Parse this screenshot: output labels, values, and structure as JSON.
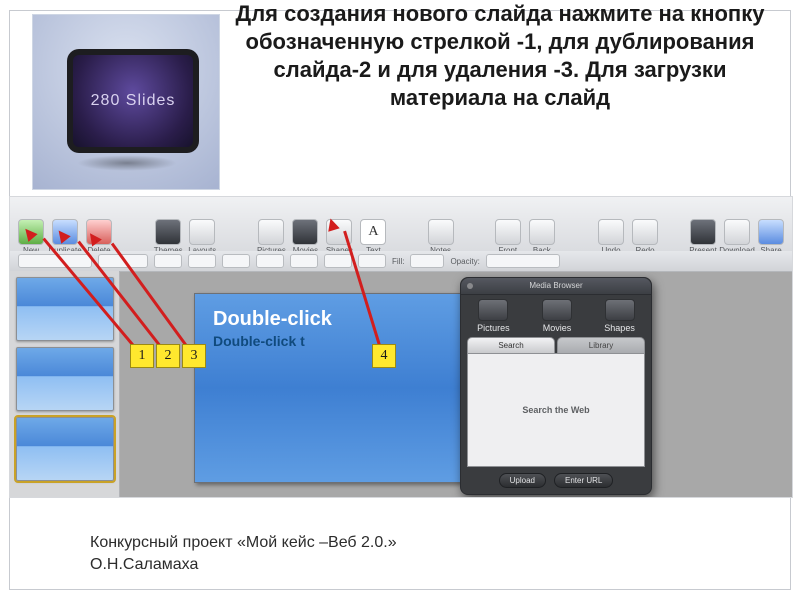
{
  "instruction_heading": "Для создания нового слайда нажмите на кнопку обозначенную стрелкой -1, для дублирования слайда-2 и для удаления -3. Для загрузки материала на слайд",
  "logo_text": "280 Slides",
  "toolbar": {
    "new": "New",
    "duplicate": "Duplicate",
    "delete": "Delete",
    "themes": "Themes",
    "layouts": "Layouts",
    "pictures": "Pictures",
    "movies": "Movies",
    "shapes": "Shapes",
    "text": "Text",
    "notes": "Notes",
    "front": "Front",
    "back": "Back",
    "undo": "Undo",
    "redo": "Redo",
    "present": "Present",
    "download": "Download",
    "share": "Share"
  },
  "toolbar2": {
    "fill_label": "Fill:",
    "opacity_label": "Opacity:"
  },
  "slide": {
    "line1": "Double-click",
    "line2": "Double-click t"
  },
  "media_browser": {
    "title": "Media Browser",
    "cat_pictures": "Pictures",
    "cat_movies": "Movies",
    "cat_shapes": "Shapes",
    "tab_search": "Search",
    "tab_library": "Library",
    "body_text": "Search the Web",
    "btn_upload": "Upload",
    "btn_enter_url": "Enter URL"
  },
  "callouts": {
    "n1": "1",
    "n2": "2",
    "n3": "3",
    "n4": "4"
  },
  "credit": "Конкурсный проект «Мой кейс –Веб 2.0.»\nО.Н.Саламаха"
}
